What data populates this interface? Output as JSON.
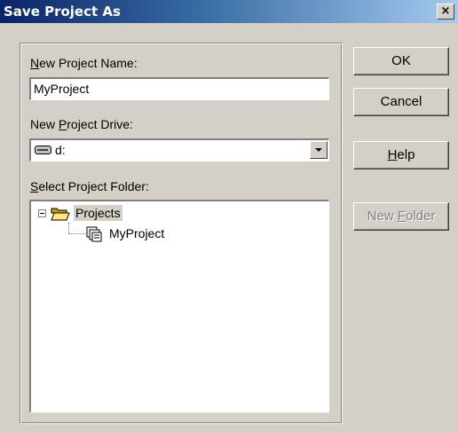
{
  "window": {
    "title": "Save Project As",
    "close_glyph": "×"
  },
  "form": {
    "name_label_key": "N",
    "name_label_rest": "ew Project Name:",
    "name_value": "MyProject",
    "drive_label_pre": "New ",
    "drive_label_key": "P",
    "drive_label_rest": "roject Drive:",
    "drive_value": "d:",
    "drive_icon": "drive-icon",
    "folder_label_key": "S",
    "folder_label_rest": "elect Project Folder:"
  },
  "tree": {
    "items": [
      {
        "label": "Projects",
        "icon": "open-folder-icon",
        "expanded": true,
        "selected": true
      },
      {
        "label": "MyProject",
        "icon": "project-icon",
        "expanded": false,
        "selected": false
      }
    ]
  },
  "buttons": {
    "ok": "OK",
    "cancel": "Cancel",
    "help_key": "H",
    "help_rest": "elp",
    "new_folder_pre": "New ",
    "new_folder_key": "F",
    "new_folder_rest": "older",
    "new_folder_enabled": false
  },
  "colors": {
    "title_bar_start": "#0a246a",
    "title_bar_end": "#a6caf0",
    "dialog_face": "#d4d0c8",
    "disabled_text": "#808080"
  }
}
